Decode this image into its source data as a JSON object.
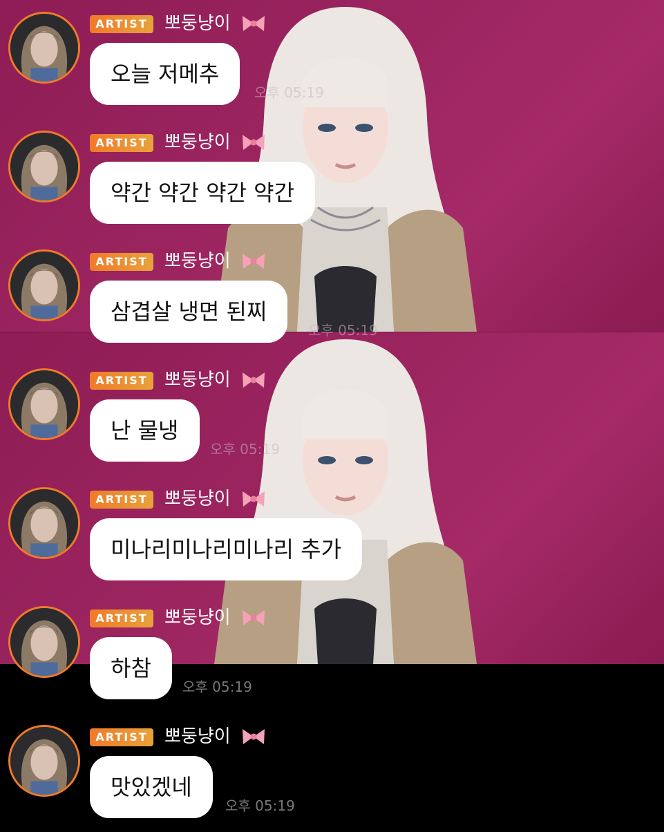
{
  "artist_badge": "ARTIST",
  "username": "뽀둥냥이",
  "accent_color": "#f07a2a",
  "bubble_color": "#ffffff",
  "bow_icon": "pink-ribbon-bow-emoji",
  "messages": [
    {
      "text": "오늘 저메추",
      "time": "오후 05:19"
    },
    {
      "text": "약간 약간 약간 약간",
      "time": ""
    },
    {
      "text": "삼겹살 냉면 된찌",
      "time": "오후 05:19"
    },
    {
      "text": "난 물냉",
      "time": "오후 05:19"
    },
    {
      "text": "미나리미나리미나리 추가",
      "time": ""
    },
    {
      "text": "하참",
      "time": "오후 05:19"
    },
    {
      "text": "맛있겠네",
      "time": "오후 05:19"
    }
  ]
}
